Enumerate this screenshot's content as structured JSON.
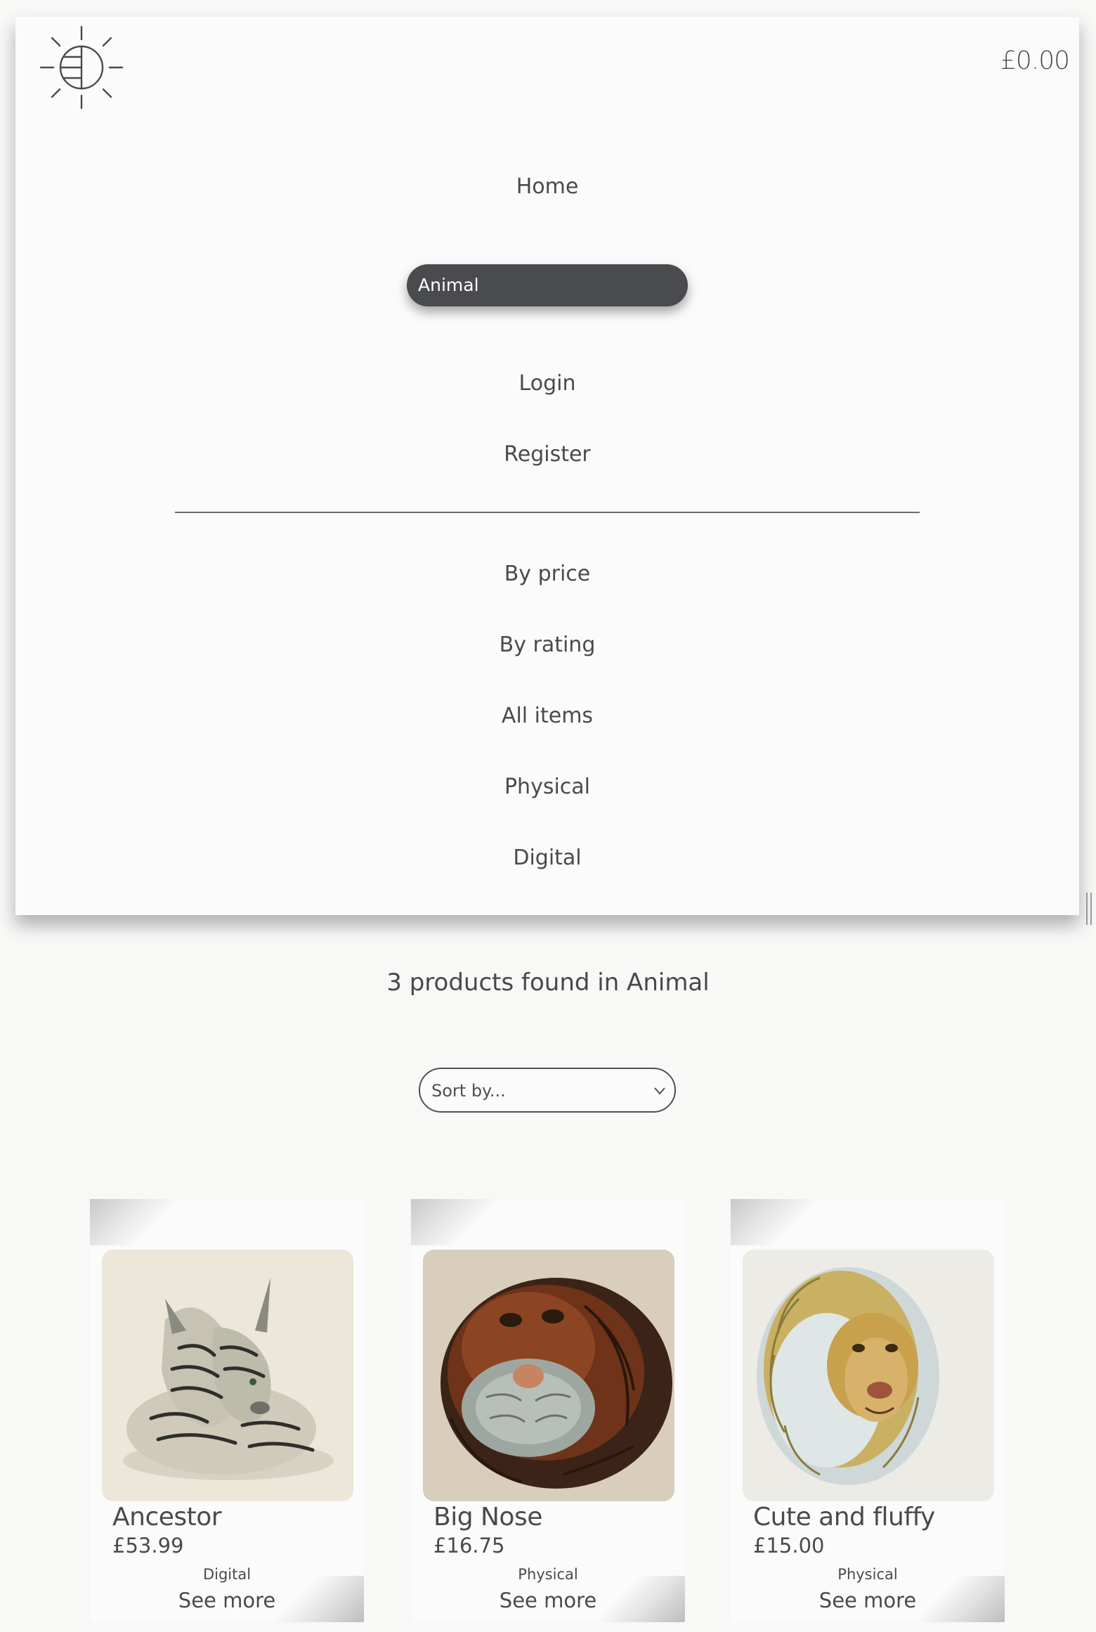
{
  "header": {
    "basket_total": "£0.00"
  },
  "nav": {
    "home": "Home",
    "active_category": "Animal",
    "login": "Login",
    "register": "Register"
  },
  "filters": {
    "by_price": "By price",
    "by_rating": "By rating",
    "all_items": "All items",
    "physical": "Physical",
    "digital": "Digital"
  },
  "results": {
    "summary": "3 products found in Animal"
  },
  "sort": {
    "placeholder": "Sort by..."
  },
  "products": [
    {
      "name": "Ancestor",
      "price": "£53.99",
      "type": "Digital",
      "link": "See more"
    },
    {
      "name": "Big Nose",
      "price": "£16.75",
      "type": "Physical",
      "link": "See more"
    },
    {
      "name": "Cute and fluffy",
      "price": "£15.00",
      "type": "Physical",
      "link": "See more"
    }
  ],
  "icons": {
    "logo": "sun-globe-icon",
    "sort_chevron": "chevron-down-icon"
  },
  "colors": {
    "active_pill": "#4a4b4f",
    "text": "#4a4a4c",
    "background": "#f8f8f7"
  }
}
